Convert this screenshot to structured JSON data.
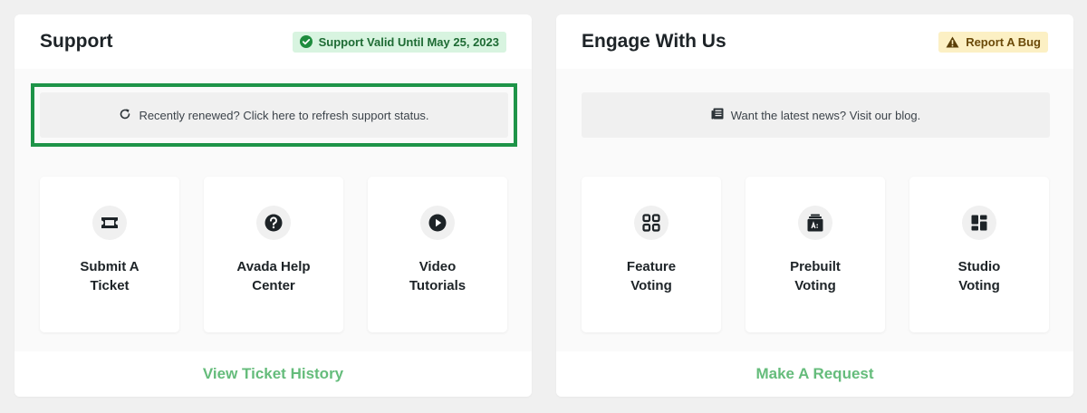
{
  "support": {
    "title": "Support",
    "badge": "Support Valid Until May 25, 2023",
    "notice": "Recently renewed? Click here to refresh support status.",
    "cards": [
      {
        "line1": "Submit A",
        "line2": "Ticket",
        "icon": "ticket-icon"
      },
      {
        "line1": "Avada Help",
        "line2": "Center",
        "icon": "question-icon"
      },
      {
        "line1": "Video",
        "line2": "Tutorials",
        "icon": "play-icon"
      }
    ],
    "footer_link": "View Ticket History"
  },
  "engage": {
    "title": "Engage With Us",
    "badge": "Report A Bug",
    "notice": "Want the latest news? Visit our blog.",
    "cards": [
      {
        "line1": "Feature",
        "line2": "Voting",
        "icon": "grid-icon"
      },
      {
        "line1": "Prebuilt",
        "line2": "Voting",
        "icon": "prebuilt-icon"
      },
      {
        "line1": "Studio",
        "line2": "Voting",
        "icon": "studio-icon"
      }
    ],
    "footer_link": "Make A Request"
  },
  "colors": {
    "accent_green": "#65bc7b",
    "highlight_border": "#1e9448",
    "valid_badge_bg": "#d8f4e0",
    "bug_badge_bg": "#fcf0c4"
  }
}
